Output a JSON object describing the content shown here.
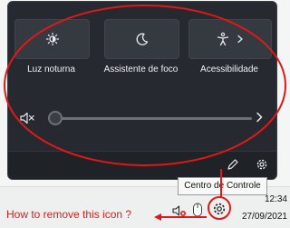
{
  "quick_settings": {
    "tiles": [
      {
        "label": "Luz noturna",
        "icon": "night-light-icon"
      },
      {
        "label": "Assistente de foco",
        "icon": "focus-assist-moon-icon"
      },
      {
        "label": "Acessibilidade",
        "icon": "accessibility-icon"
      }
    ],
    "volume": {
      "icon": "speaker-muted-icon",
      "level": 0,
      "more_icon": "chevron-right-icon"
    },
    "footer": {
      "edit_icon": "pencil-icon",
      "settings_icon": "gear-icon"
    }
  },
  "taskbar": {
    "tray_icons": [
      "speaker-muted-icon",
      "mouse-icon",
      "gear-icon"
    ],
    "time": "12:34",
    "date": "27/09/2021"
  },
  "tooltip": {
    "text": "Centro de Controle"
  },
  "annotation": {
    "text": "How to remove this icon ?",
    "color": "#d21f1f"
  },
  "colors": {
    "panel_bg": "#262a30",
    "tile_bg": "#353a41",
    "taskbar_bg": "#eef0f0",
    "annotation_red": "#d21f1f"
  }
}
